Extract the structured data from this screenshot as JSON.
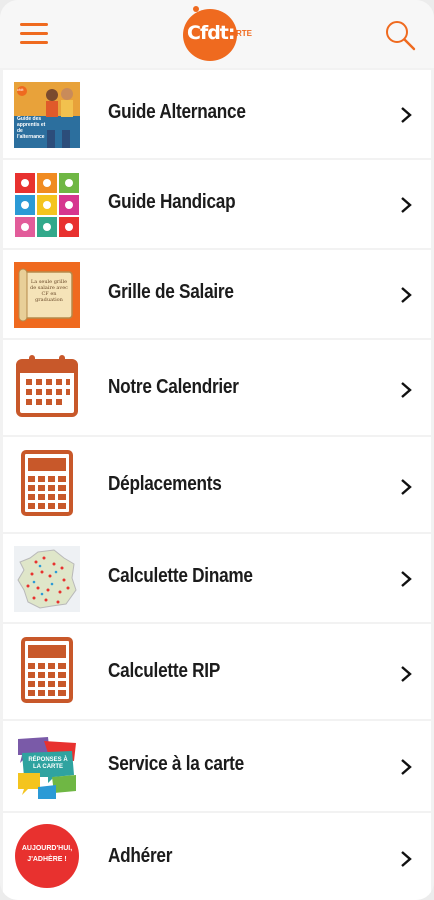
{
  "header": {
    "logo_text": "Cfdt:",
    "logo_sub": "RTE",
    "menu_icon": "hamburger-menu-icon",
    "search_icon": "search-icon",
    "accent": "#ef6a1f"
  },
  "thumbs": {
    "guide_alternance_text": "Guide des apprentis et de l'alternance",
    "guide_alternance_badge": "cfdt",
    "grille_text": "La seule grille de salaire avec CF en graduation",
    "service_text": "RÉPONSES À LA CARTE",
    "adherer_text_1": "AUJOURD'HUI,",
    "adherer_text_2": "J'ADHÈRE !"
  },
  "items": [
    {
      "label": "Guide Alternance",
      "icon": "guide-alternance-thumbnail"
    },
    {
      "label": "Guide Handicap",
      "icon": "handicap-pictograms-thumbnail"
    },
    {
      "label": "Grille de Salaire",
      "icon": "salary-grid-paper-thumbnail"
    },
    {
      "label": "Notre Calendrier",
      "icon": "calendar-icon"
    },
    {
      "label": "Déplacements",
      "icon": "calculator-icon"
    },
    {
      "label": "Calculette Diname",
      "icon": "france-map-thumbnail"
    },
    {
      "label": "Calculette RIP",
      "icon": "calculator-icon"
    },
    {
      "label": "Service à la carte",
      "icon": "speech-bubbles-thumbnail"
    },
    {
      "label": "Adhérer",
      "icon": "join-badge-icon"
    }
  ]
}
